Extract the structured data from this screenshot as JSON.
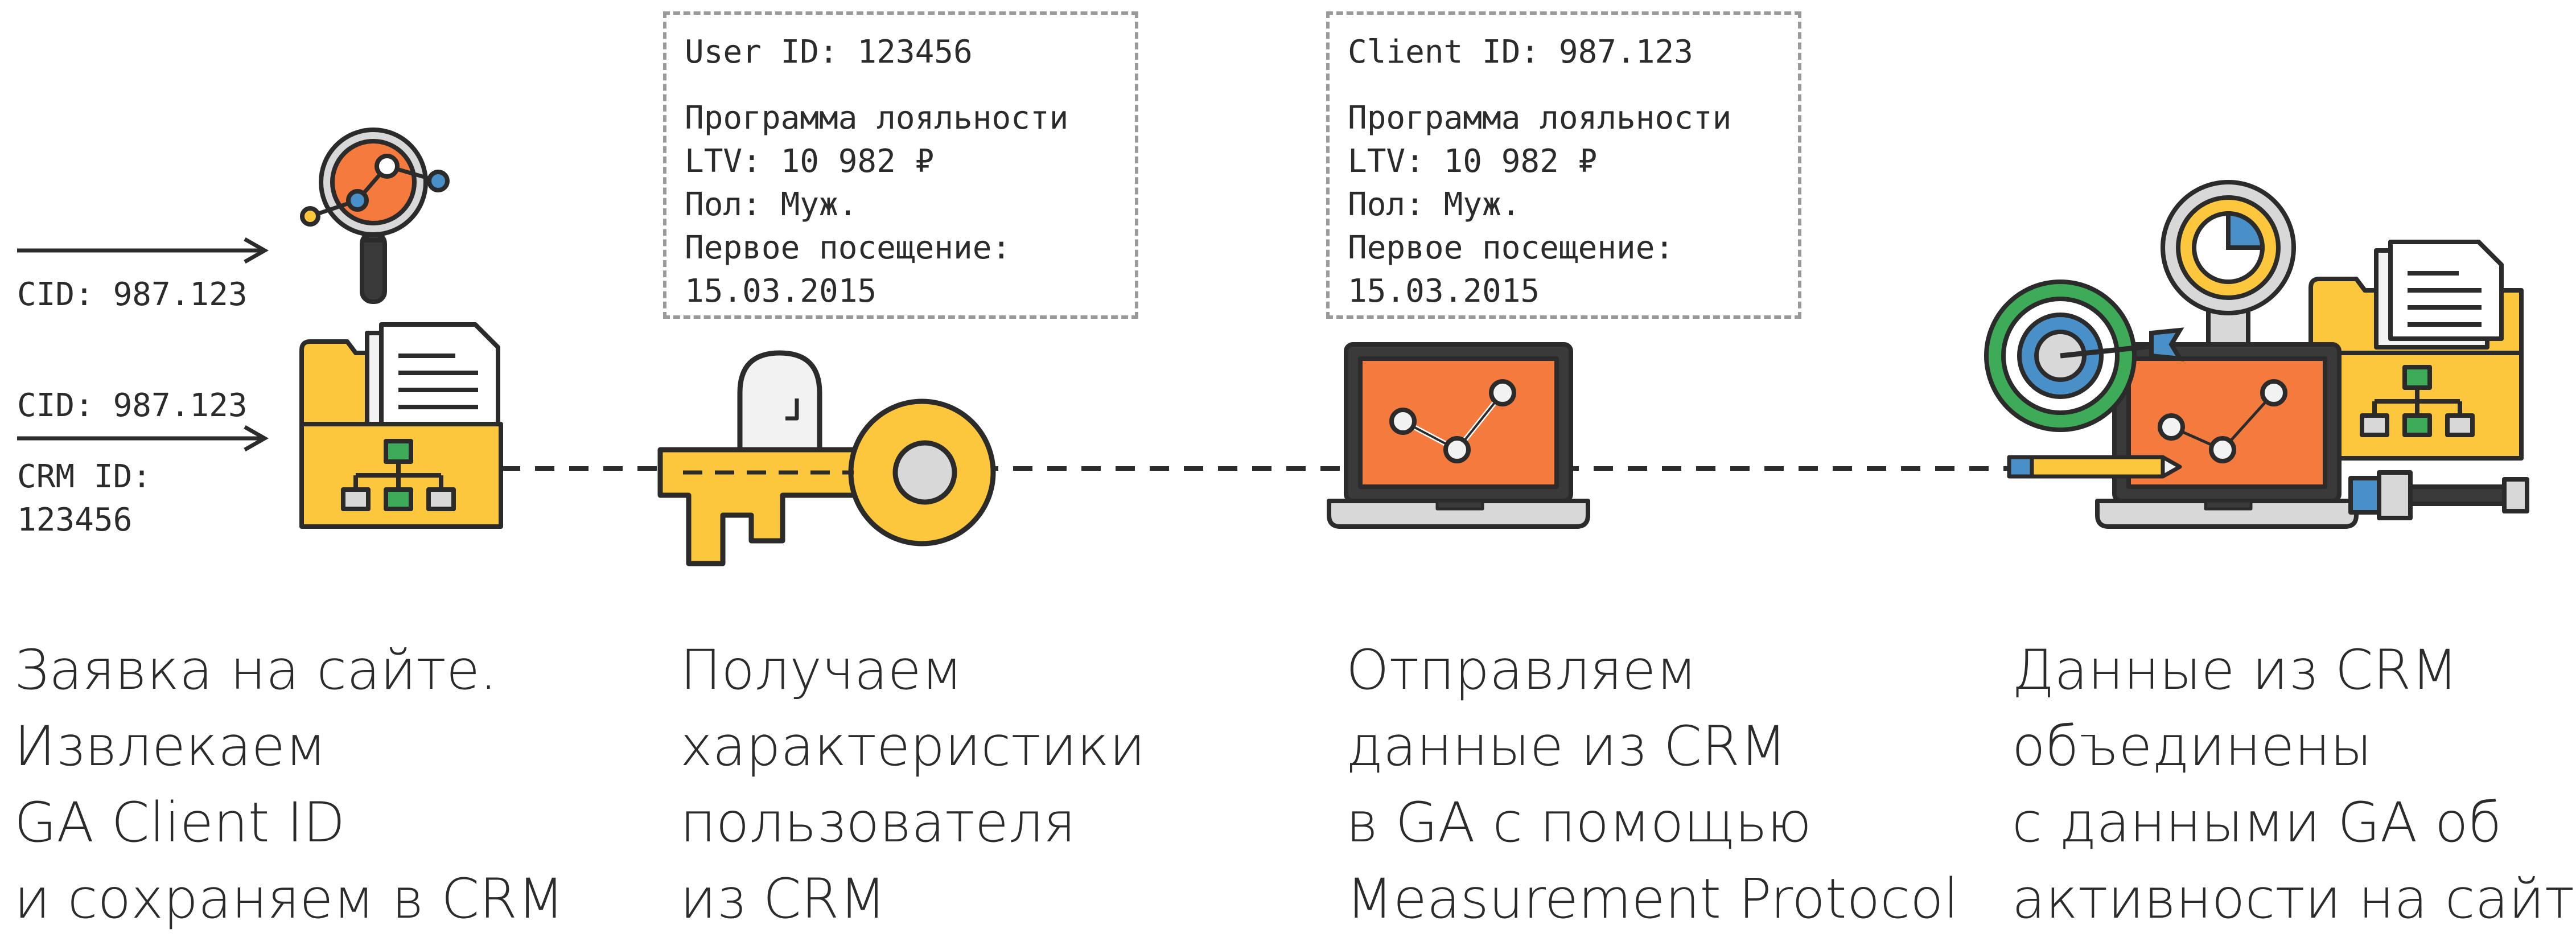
{
  "left_labels": {
    "cid_top": "CID: 987.123",
    "cid_bottom": "CID: 987.123",
    "crm_id_label": "CRM ID:",
    "crm_id_value": "123456"
  },
  "box_user": {
    "id_line": "User ID: 123456",
    "lines": [
      "Программа лояльности",
      "LTV: 10 982 ₽",
      "Пол: Муж.",
      "Первое посещение:",
      "15.03.2015"
    ]
  },
  "box_client": {
    "id_line": "Client ID: 987.123",
    "lines": [
      "Программа лояльности",
      "LTV: 10 982 ₽",
      "Пол: Муж.",
      "Первое посещение:",
      "15.03.2015"
    ]
  },
  "captions": [
    [
      "Заявка на сайте.",
      "Извлекаем",
      "GA Client ID",
      "и сохраняем в CRM"
    ],
    [
      "Получаем",
      "характеристики",
      "пользователя",
      "из CRM"
    ],
    [
      "Отправляем",
      "данные из CRM",
      "в GA с помощью",
      "Measurement Protocol"
    ],
    [
      "Данные из CRM",
      "объединены",
      "с данными GA об",
      "активности на сайте"
    ]
  ],
  "colors": {
    "outline": "#2b2b2b",
    "yellow": "#fcc73c",
    "orange": "#f47a3d",
    "green": "#3dab58",
    "blue": "#4a90c8",
    "gray": "#d8d8d8",
    "dash_border": "#9a9a9a"
  },
  "icons": [
    "arrow-right-icon",
    "magnifier-chart-icon",
    "folder-document-icon",
    "key-icon",
    "laptop-chart-icon",
    "target-icon",
    "gauge-icon",
    "pencil-icon",
    "screwdriver-icon"
  ]
}
